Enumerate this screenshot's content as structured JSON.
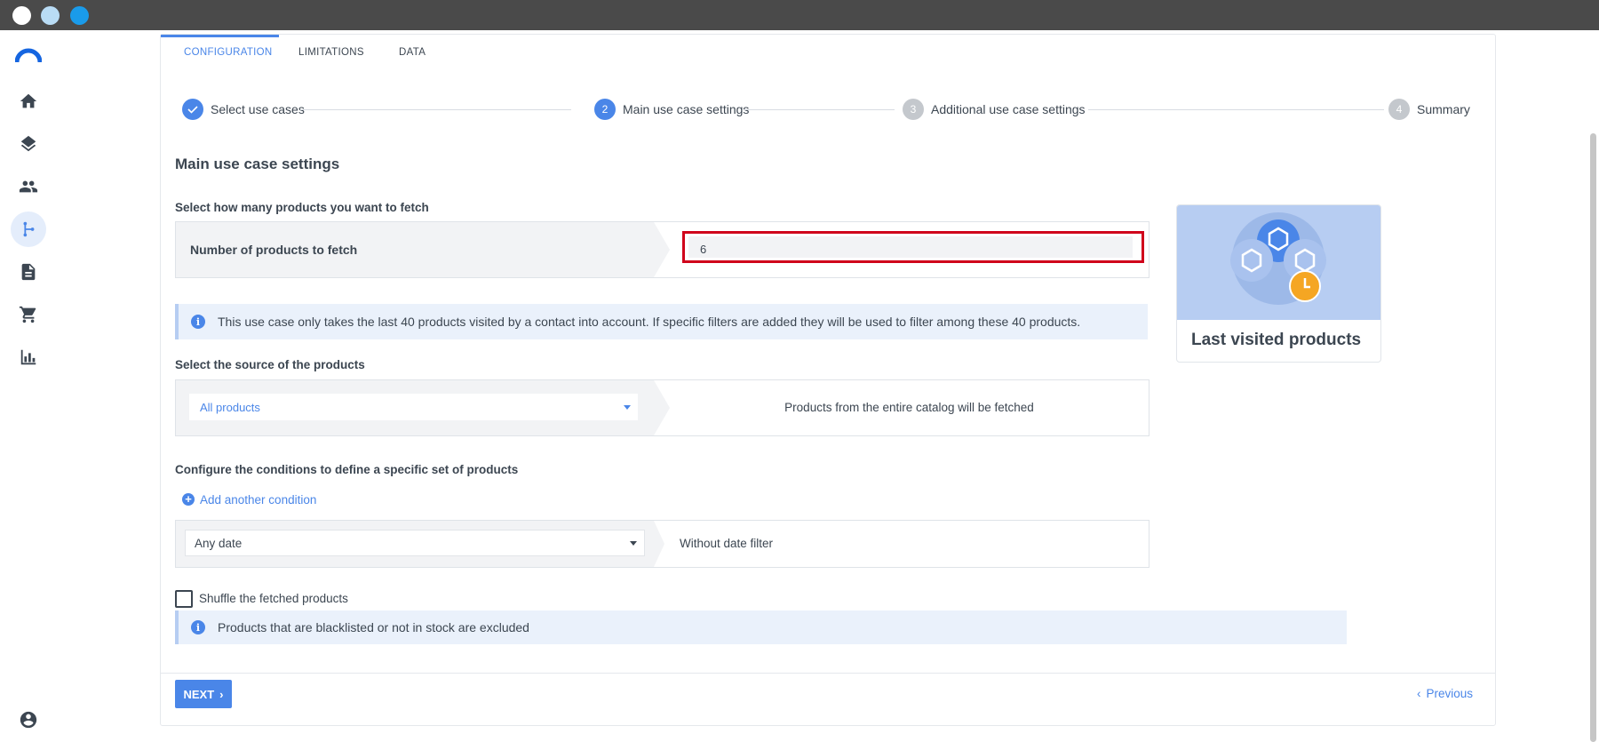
{
  "tabs": [
    "CONFIGURATION",
    "LIMITATIONS",
    "DATA"
  ],
  "steps": [
    {
      "number": "",
      "label": "Select use cases"
    },
    {
      "number": "2",
      "label": "Main use case settings"
    },
    {
      "number": "3",
      "label": "Additional use case settings"
    },
    {
      "number": "4",
      "label": "Summary"
    }
  ],
  "section_title": "Main use case settings",
  "fetch": {
    "question": "Select how many products you want to fetch",
    "label": "Number of products to fetch",
    "value": "6"
  },
  "info_message": "This use case only takes the last 40 products visited by a contact into account. If specific filters are added they will be used to filter among these 40 products.",
  "source": {
    "question": "Select the source of the products",
    "selected": "All products",
    "description": "Products from the entire catalog will be fetched"
  },
  "conditions": {
    "question": "Configure the conditions to define a specific set of products",
    "add_label": "Add another condition",
    "date_selected": "Any date",
    "date_description": "Without date filter"
  },
  "shuffle_label": "Shuffle the fetched products",
  "excluded_note": "Products that are blacklisted or not in stock are excluded",
  "use_case_card": {
    "title": "Last visited products"
  },
  "buttons": {
    "next": "NEXT",
    "previous": "Previous"
  },
  "colors": {
    "accent": "#4a86e8",
    "highlight_border": "#d0021b",
    "step_inactive": "#c4c8cd",
    "clock_badge": "#f5a623"
  }
}
